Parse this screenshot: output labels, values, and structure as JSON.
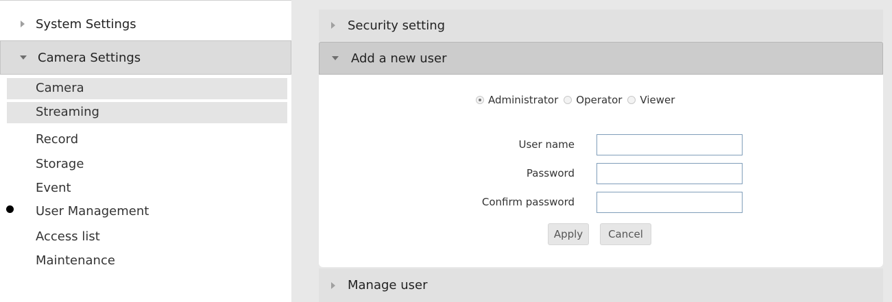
{
  "sidebar": {
    "system_settings": "System Settings",
    "camera_settings": "Camera Settings",
    "items": [
      {
        "label": "Camera"
      },
      {
        "label": "Streaming"
      },
      {
        "label": "Record"
      },
      {
        "label": "Storage"
      },
      {
        "label": "Event"
      },
      {
        "label": "User Management"
      },
      {
        "label": "Access list"
      },
      {
        "label": "Maintenance"
      }
    ]
  },
  "main": {
    "security_setting": "Security setting",
    "add_user": "Add a new user",
    "manage_user": "Manage user",
    "roles": [
      {
        "label": "Administrator",
        "selected": true
      },
      {
        "label": "Operator",
        "selected": false
      },
      {
        "label": "Viewer",
        "selected": false
      }
    ],
    "fields": {
      "username_label": "User name",
      "username_value": "",
      "password_label": "Password",
      "password_value": "",
      "confirm_label": "Confirm password",
      "confirm_value": ""
    },
    "apply_label": "Apply",
    "cancel_label": "Cancel"
  }
}
